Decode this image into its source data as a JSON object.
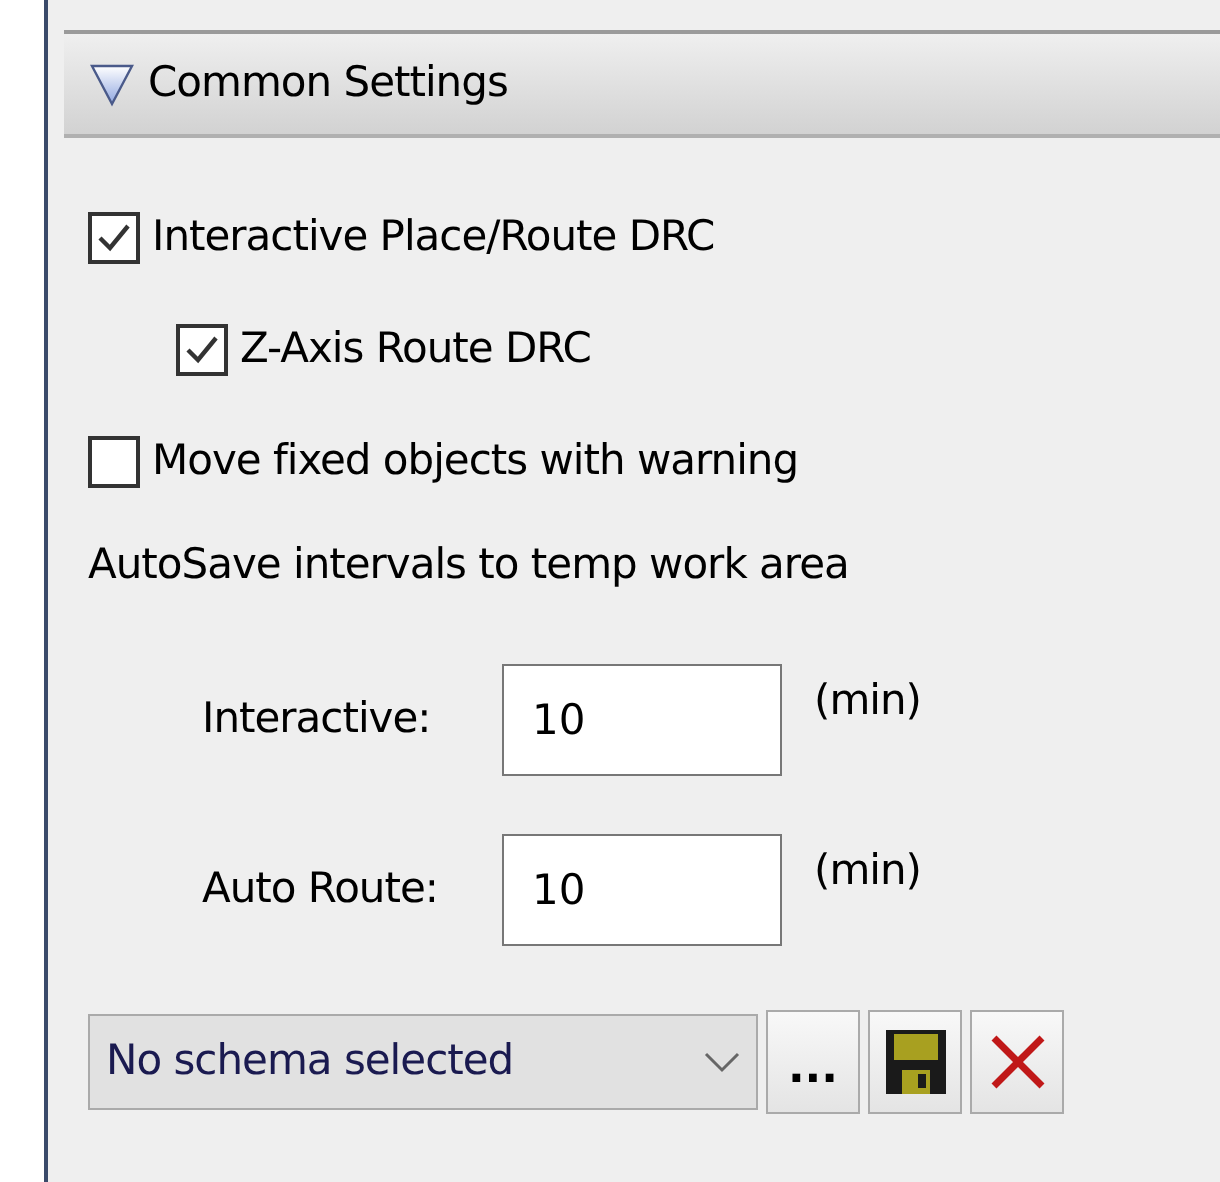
{
  "section": {
    "title": "Common Settings",
    "expanded": true
  },
  "options": [
    {
      "label": "Interactive Place/Route DRC",
      "checked": true,
      "children": [
        {
          "label": "Z-Axis Route DRC",
          "checked": true
        }
      ]
    },
    {
      "label": "Move fixed objects with warning",
      "checked": false
    }
  ],
  "autosave": {
    "heading": "AutoSave intervals to temp work area",
    "fields": [
      {
        "label": "Interactive:",
        "value": "10",
        "unit": "(min)"
      },
      {
        "label": "Auto Route:",
        "value": "10",
        "unit": "(min)"
      }
    ]
  },
  "schema": {
    "value": "No schema selected",
    "browse_label": "..."
  }
}
